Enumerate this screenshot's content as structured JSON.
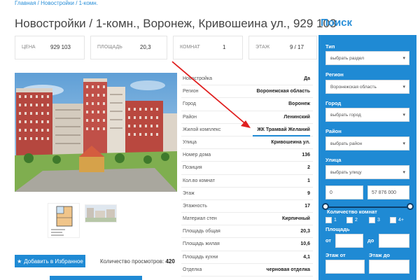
{
  "breadcrumb": [
    "Главная",
    "Новостройки",
    "1-комн."
  ],
  "title": "Новостройки / 1-комн., Воронеж, Кривошеина ул., 929 103",
  "stats": [
    {
      "label": "ЦЕНА",
      "value": "929 103"
    },
    {
      "label": "ПЛОЩАДЬ",
      "value": "20,3"
    },
    {
      "label": "КОМНАТ",
      "value": "1"
    },
    {
      "label": "ЭТАЖ",
      "value": "9 / 17"
    }
  ],
  "properties": [
    {
      "key": "Новостройка",
      "value": "Да"
    },
    {
      "key": "Регион",
      "value": "Воронежская область"
    },
    {
      "key": "Город",
      "value": "Воронеж"
    },
    {
      "key": "Район",
      "value": "Ленинский"
    },
    {
      "key": "Жилой комплекс",
      "value": "ЖК Трамвай Желаний"
    },
    {
      "key": "Улица",
      "value": "Кривошеина ул."
    },
    {
      "key": "Номер дома",
      "value": "136"
    },
    {
      "key": "Позиция",
      "value": "2"
    },
    {
      "key": "Кол.во комнат",
      "value": "1"
    },
    {
      "key": "Этаж",
      "value": "9"
    },
    {
      "key": "Этажность",
      "value": "17"
    },
    {
      "key": "Материал стен",
      "value": "Кирпичный"
    },
    {
      "key": "Площадь общая",
      "value": "20,3"
    },
    {
      "key": "Площадь жилая",
      "value": "10,6"
    },
    {
      "key": "Площадь кухни",
      "value": "4,1"
    },
    {
      "key": "Отделка",
      "value": "черновая отделка"
    }
  ],
  "favorite_label": "Добавить в Избранное",
  "views": {
    "label": "Количество просмотров:",
    "count": "420"
  },
  "sidebar": {
    "title": "Поиск",
    "filters": {
      "type": {
        "label": "Тип",
        "value": "выбрать раздел"
      },
      "region": {
        "label": "Регион",
        "value": "Воронежская область"
      },
      "city": {
        "label": "Город",
        "value": "выбрать город"
      },
      "district": {
        "label": "Район",
        "value": "выбрать район"
      },
      "street": {
        "label": "Улица",
        "value": "выбрать улицу"
      }
    },
    "price_min": "0",
    "price_max": "57 876 000",
    "rooms_label": "Количество комнат",
    "rooms": [
      "1",
      "2",
      "3",
      "4+"
    ],
    "area_label": "Площадь",
    "from_label": "от",
    "to_label": "до",
    "floor_from_label": "Этаж от",
    "floor_to_label": "Этаж до"
  },
  "colors": {
    "accent": "#1f8ad4",
    "annotation_arrow": "#e02020"
  },
  "icons": {
    "favorite": "star-icon",
    "select": "chevron-down-icon"
  }
}
